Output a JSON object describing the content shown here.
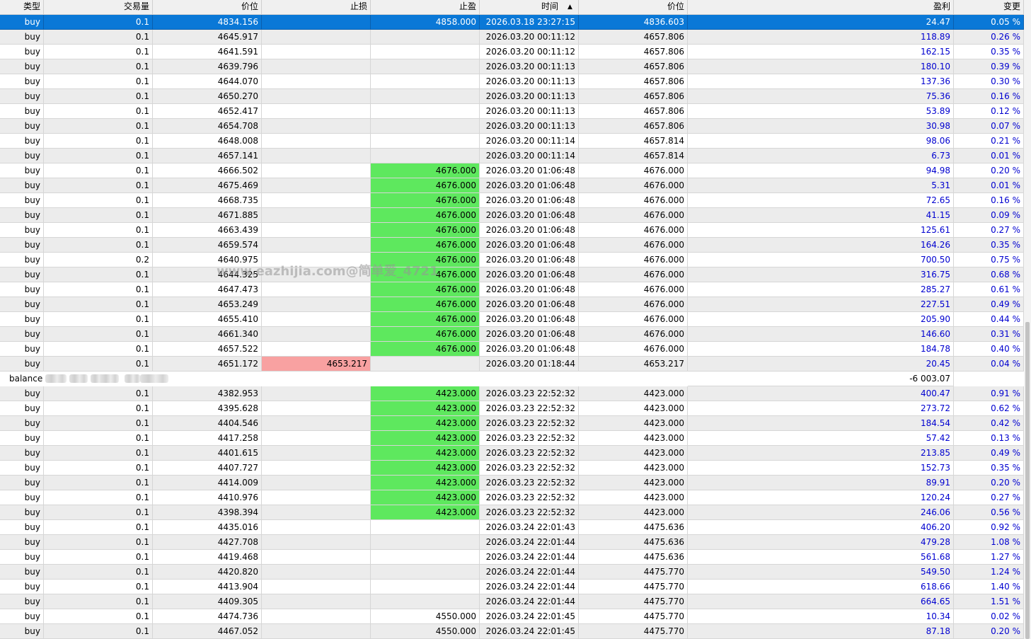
{
  "columns": {
    "type": "类型",
    "volume": "交易量",
    "price": "价位",
    "sl": "止损",
    "tp": "止盈",
    "time": "时间",
    "close_price": "价位",
    "profit": "盈利",
    "change": "变更"
  },
  "sort_indicator": "▲",
  "watermark": "www.eazhijia.com@简单爱_4721",
  "colors": {
    "selection": "#0a78d7",
    "take_profit_hit": "#5ee85e",
    "stop_loss_hit": "#f8a1a1",
    "profit_text": "#0000d0"
  },
  "rows": [
    {
      "type": "buy",
      "vol": "0.1",
      "price": "4834.156",
      "sl": "",
      "tp": "4858.000",
      "time": "2026.03.18 23:27:15",
      "close": "4836.603",
      "profit": "24.47",
      "change": "0.05 %"
    },
    {
      "type": "buy",
      "vol": "0.1",
      "price": "4645.917",
      "sl": "",
      "tp": "",
      "time": "2026.03.20 00:11:12",
      "close": "4657.806",
      "profit": "118.89",
      "change": "0.26 %"
    },
    {
      "type": "buy",
      "vol": "0.1",
      "price": "4641.591",
      "sl": "",
      "tp": "",
      "time": "2026.03.20 00:11:12",
      "close": "4657.806",
      "profit": "162.15",
      "change": "0.35 %"
    },
    {
      "type": "buy",
      "vol": "0.1",
      "price": "4639.796",
      "sl": "",
      "tp": "",
      "time": "2026.03.20 00:11:13",
      "close": "4657.806",
      "profit": "180.10",
      "change": "0.39 %"
    },
    {
      "type": "buy",
      "vol": "0.1",
      "price": "4644.070",
      "sl": "",
      "tp": "",
      "time": "2026.03.20 00:11:13",
      "close": "4657.806",
      "profit": "137.36",
      "change": "0.30 %"
    },
    {
      "type": "buy",
      "vol": "0.1",
      "price": "4650.270",
      "sl": "",
      "tp": "",
      "time": "2026.03.20 00:11:13",
      "close": "4657.806",
      "profit": "75.36",
      "change": "0.16 %"
    },
    {
      "type": "buy",
      "vol": "0.1",
      "price": "4652.417",
      "sl": "",
      "tp": "",
      "time": "2026.03.20 00:11:13",
      "close": "4657.806",
      "profit": "53.89",
      "change": "0.12 %"
    },
    {
      "type": "buy",
      "vol": "0.1",
      "price": "4654.708",
      "sl": "",
      "tp": "",
      "time": "2026.03.20 00:11:13",
      "close": "4657.806",
      "profit": "30.98",
      "change": "0.07 %"
    },
    {
      "type": "buy",
      "vol": "0.1",
      "price": "4648.008",
      "sl": "",
      "tp": "",
      "time": "2026.03.20 00:11:14",
      "close": "4657.814",
      "profit": "98.06",
      "change": "0.21 %"
    },
    {
      "type": "buy",
      "vol": "0.1",
      "price": "4657.141",
      "sl": "",
      "tp": "",
      "time": "2026.03.20 00:11:14",
      "close": "4657.814",
      "profit": "6.73",
      "change": "0.01 %"
    },
    {
      "type": "buy",
      "vol": "0.1",
      "price": "4666.502",
      "sl": "",
      "tp": "4676.000",
      "time": "2026.03.20 01:06:48",
      "close": "4676.000",
      "profit": "94.98",
      "change": "0.20 %"
    },
    {
      "type": "buy",
      "vol": "0.1",
      "price": "4675.469",
      "sl": "",
      "tp": "4676.000",
      "time": "2026.03.20 01:06:48",
      "close": "4676.000",
      "profit": "5.31",
      "change": "0.01 %"
    },
    {
      "type": "buy",
      "vol": "0.1",
      "price": "4668.735",
      "sl": "",
      "tp": "4676.000",
      "time": "2026.03.20 01:06:48",
      "close": "4676.000",
      "profit": "72.65",
      "change": "0.16 %"
    },
    {
      "type": "buy",
      "vol": "0.1",
      "price": "4671.885",
      "sl": "",
      "tp": "4676.000",
      "time": "2026.03.20 01:06:48",
      "close": "4676.000",
      "profit": "41.15",
      "change": "0.09 %"
    },
    {
      "type": "buy",
      "vol": "0.1",
      "price": "4663.439",
      "sl": "",
      "tp": "4676.000",
      "time": "2026.03.20 01:06:48",
      "close": "4676.000",
      "profit": "125.61",
      "change": "0.27 %"
    },
    {
      "type": "buy",
      "vol": "0.1",
      "price": "4659.574",
      "sl": "",
      "tp": "4676.000",
      "time": "2026.03.20 01:06:48",
      "close": "4676.000",
      "profit": "164.26",
      "change": "0.35 %"
    },
    {
      "type": "buy",
      "vol": "0.2",
      "price": "4640.975",
      "sl": "",
      "tp": "4676.000",
      "time": "2026.03.20 01:06:48",
      "close": "4676.000",
      "profit": "700.50",
      "change": "0.75 %"
    },
    {
      "type": "buy",
      "vol": "0.1",
      "price": "4644.325",
      "sl": "",
      "tp": "4676.000",
      "time": "2026.03.20 01:06:48",
      "close": "4676.000",
      "profit": "316.75",
      "change": "0.68 %"
    },
    {
      "type": "buy",
      "vol": "0.1",
      "price": "4647.473",
      "sl": "",
      "tp": "4676.000",
      "time": "2026.03.20 01:06:48",
      "close": "4676.000",
      "profit": "285.27",
      "change": "0.61 %"
    },
    {
      "type": "buy",
      "vol": "0.1",
      "price": "4653.249",
      "sl": "",
      "tp": "4676.000",
      "time": "2026.03.20 01:06:48",
      "close": "4676.000",
      "profit": "227.51",
      "change": "0.49 %"
    },
    {
      "type": "buy",
      "vol": "0.1",
      "price": "4655.410",
      "sl": "",
      "tp": "4676.000",
      "time": "2026.03.20 01:06:48",
      "close": "4676.000",
      "profit": "205.90",
      "change": "0.44 %"
    },
    {
      "type": "buy",
      "vol": "0.1",
      "price": "4661.340",
      "sl": "",
      "tp": "4676.000",
      "time": "2026.03.20 01:06:48",
      "close": "4676.000",
      "profit": "146.60",
      "change": "0.31 %"
    },
    {
      "type": "buy",
      "vol": "0.1",
      "price": "4657.522",
      "sl": "",
      "tp": "4676.000",
      "time": "2026.03.20 01:06:48",
      "close": "4676.000",
      "profit": "184.78",
      "change": "0.40 %"
    },
    {
      "type": "buy",
      "vol": "0.1",
      "price": "4651.172",
      "sl": "4653.217",
      "tp": "",
      "time": "2026.03.20 01:18:44",
      "close": "4653.217",
      "profit": "20.45",
      "change": "0.04 %"
    },
    {
      "type": "balance",
      "profit": "-6 003.07"
    },
    {
      "type": "buy",
      "vol": "0.1",
      "price": "4382.953",
      "sl": "",
      "tp": "4423.000",
      "time": "2026.03.23 22:52:32",
      "close": "4423.000",
      "profit": "400.47",
      "change": "0.91 %"
    },
    {
      "type": "buy",
      "vol": "0.1",
      "price": "4395.628",
      "sl": "",
      "tp": "4423.000",
      "time": "2026.03.23 22:52:32",
      "close": "4423.000",
      "profit": "273.72",
      "change": "0.62 %"
    },
    {
      "type": "buy",
      "vol": "0.1",
      "price": "4404.546",
      "sl": "",
      "tp": "4423.000",
      "time": "2026.03.23 22:52:32",
      "close": "4423.000",
      "profit": "184.54",
      "change": "0.42 %"
    },
    {
      "type": "buy",
      "vol": "0.1",
      "price": "4417.258",
      "sl": "",
      "tp": "4423.000",
      "time": "2026.03.23 22:52:32",
      "close": "4423.000",
      "profit": "57.42",
      "change": "0.13 %"
    },
    {
      "type": "buy",
      "vol": "0.1",
      "price": "4401.615",
      "sl": "",
      "tp": "4423.000",
      "time": "2026.03.23 22:52:32",
      "close": "4423.000",
      "profit": "213.85",
      "change": "0.49 %"
    },
    {
      "type": "buy",
      "vol": "0.1",
      "price": "4407.727",
      "sl": "",
      "tp": "4423.000",
      "time": "2026.03.23 22:52:32",
      "close": "4423.000",
      "profit": "152.73",
      "change": "0.35 %"
    },
    {
      "type": "buy",
      "vol": "0.1",
      "price": "4414.009",
      "sl": "",
      "tp": "4423.000",
      "time": "2026.03.23 22:52:32",
      "close": "4423.000",
      "profit": "89.91",
      "change": "0.20 %"
    },
    {
      "type": "buy",
      "vol": "0.1",
      "price": "4410.976",
      "sl": "",
      "tp": "4423.000",
      "time": "2026.03.23 22:52:32",
      "close": "4423.000",
      "profit": "120.24",
      "change": "0.27 %"
    },
    {
      "type": "buy",
      "vol": "0.1",
      "price": "4398.394",
      "sl": "",
      "tp": "4423.000",
      "time": "2026.03.23 22:52:32",
      "close": "4423.000",
      "profit": "246.06",
      "change": "0.56 %"
    },
    {
      "type": "buy",
      "vol": "0.1",
      "price": "4435.016",
      "sl": "",
      "tp": "",
      "time": "2026.03.24 22:01:43",
      "close": "4475.636",
      "profit": "406.20",
      "change": "0.92 %"
    },
    {
      "type": "buy",
      "vol": "0.1",
      "price": "4427.708",
      "sl": "",
      "tp": "",
      "time": "2026.03.24 22:01:44",
      "close": "4475.636",
      "profit": "479.28",
      "change": "1.08 %"
    },
    {
      "type": "buy",
      "vol": "0.1",
      "price": "4419.468",
      "sl": "",
      "tp": "",
      "time": "2026.03.24 22:01:44",
      "close": "4475.636",
      "profit": "561.68",
      "change": "1.27 %"
    },
    {
      "type": "buy",
      "vol": "0.1",
      "price": "4420.820",
      "sl": "",
      "tp": "",
      "time": "2026.03.24 22:01:44",
      "close": "4475.770",
      "profit": "549.50",
      "change": "1.24 %"
    },
    {
      "type": "buy",
      "vol": "0.1",
      "price": "4413.904",
      "sl": "",
      "tp": "",
      "time": "2026.03.24 22:01:44",
      "close": "4475.770",
      "profit": "618.66",
      "change": "1.40 %"
    },
    {
      "type": "buy",
      "vol": "0.1",
      "price": "4409.305",
      "sl": "",
      "tp": "",
      "time": "2026.03.24 22:01:44",
      "close": "4475.770",
      "profit": "664.65",
      "change": "1.51 %"
    },
    {
      "type": "buy",
      "vol": "0.1",
      "price": "4474.736",
      "sl": "",
      "tp": "4550.000",
      "time": "2026.03.24 22:01:45",
      "close": "4475.770",
      "profit": "10.34",
      "change": "0.02 %"
    },
    {
      "type": "buy",
      "vol": "0.1",
      "price": "4467.052",
      "sl": "",
      "tp": "4550.000",
      "time": "2026.03.24 22:01:45",
      "close": "4475.770",
      "profit": "87.18",
      "change": "0.20 %"
    }
  ]
}
